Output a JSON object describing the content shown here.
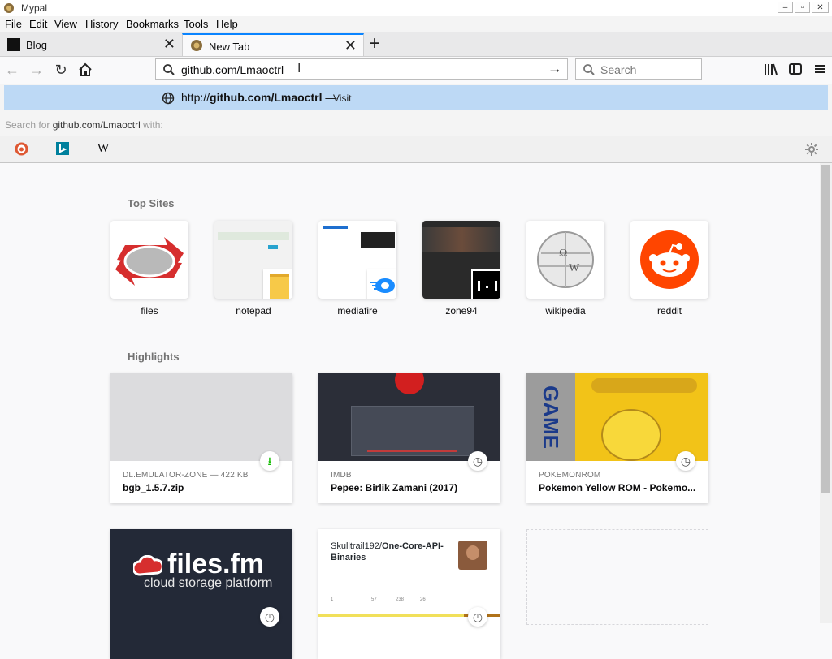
{
  "window": {
    "title": "Mypal"
  },
  "menu": {
    "file": "File",
    "edit": "Edit",
    "view": "View",
    "history": "History",
    "bookmarks": "Bookmarks",
    "tools": "Tools",
    "help": "Help"
  },
  "tabs": [
    {
      "label": "Blog"
    },
    {
      "label": "New Tab"
    }
  ],
  "urlbar": {
    "value": "github.com/Lmaoctrl"
  },
  "searchbar": {
    "placeholder": "Search"
  },
  "autocomplete": {
    "url_prefix": "http://",
    "url_domain": "github.com/Lmaoctrl",
    "separator": "—",
    "action": "Visit",
    "search_with_prefix": "Search for",
    "search_with_term": "github.com/Lmaoctrl",
    "search_with_suffix": "with:",
    "engines": [
      "duckduckgo",
      "bing",
      "W"
    ]
  },
  "newtab": {
    "top_sites_heading": "Top Sites",
    "top_sites": [
      {
        "label": "files"
      },
      {
        "label": "notepad"
      },
      {
        "label": "mediafire"
      },
      {
        "label": "zone94"
      },
      {
        "label": "wikipedia"
      },
      {
        "label": "reddit"
      }
    ],
    "highlights_heading": "Highlights",
    "highlights": [
      {
        "source": "DL.EMULATOR-ZONE — 422 KB",
        "title": "bgb_1.5.7.zip"
      },
      {
        "source": "IMDB",
        "title": "Pepee: Birlik Zamani (2017)"
      },
      {
        "source": "POKEMONROM",
        "title": "Pokemon Yellow ROM - Pokemo..."
      },
      {
        "logo_text": "files.fm",
        "logo_sub": "cloud storage platform"
      },
      {
        "repo_user": "Skulltrail192/",
        "repo_name": "One-Core-API-Binaries",
        "stats": [
          "1",
          "57",
          "238",
          "26"
        ]
      }
    ]
  },
  "colors": {
    "accent": "#0a84ff",
    "suggest_bg": "#bdd9f5",
    "reddit": "#ff4500",
    "files_red": "#d62e2e"
  }
}
